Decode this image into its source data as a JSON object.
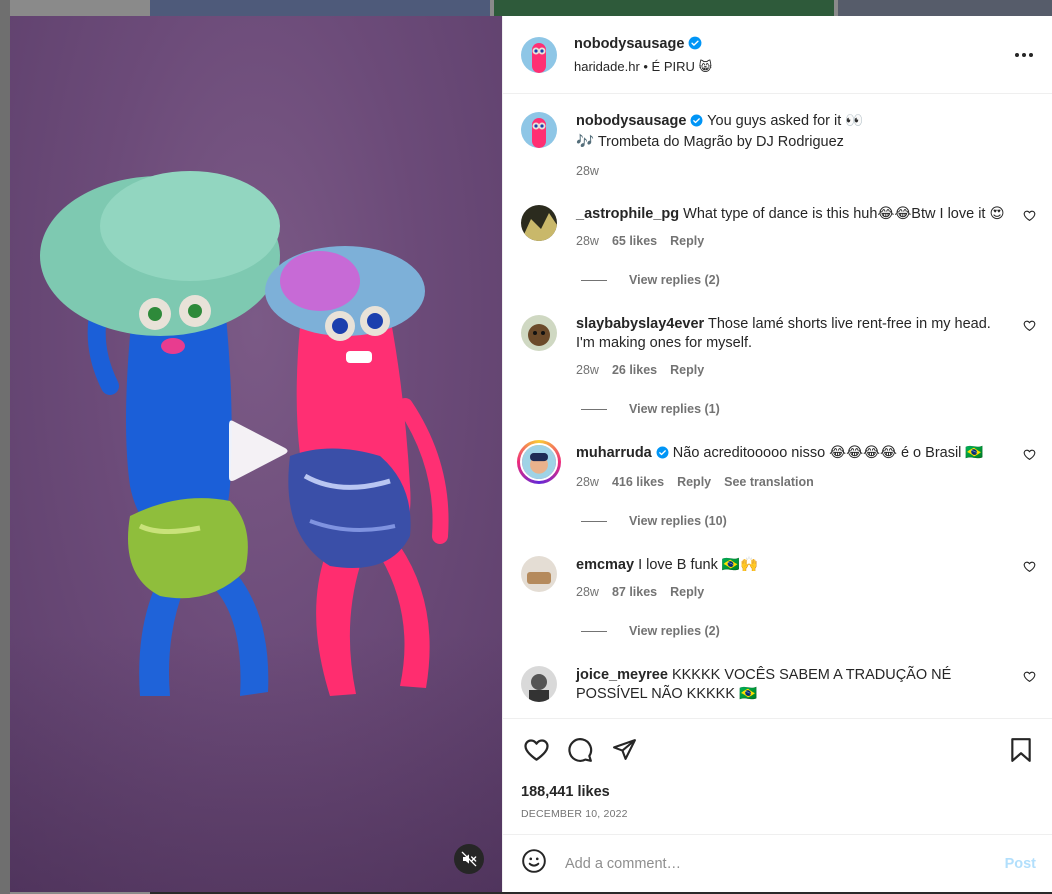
{
  "post": {
    "author": "nobodysausage",
    "location_line": "haridade.hr • É PIRU 😸",
    "caption_text": "You guys asked for it 👀",
    "caption_music": "🎶 Trombeta do Magrão by DJ Rodriguez",
    "caption_time": "28w",
    "likes": "188,441 likes",
    "date": "DECEMBER 10, 2022"
  },
  "comments": [
    {
      "user": "_astrophile_pg",
      "text": "What type of dance is this huh😂😂Btw I love it 😍",
      "time": "28w",
      "likes": "65 likes",
      "reply": "Reply",
      "view_replies": "View replies (2)"
    },
    {
      "user": "slaybabyslay4ever",
      "text": "Those lamé shorts live rent-free in my head. I'm making ones for myself.",
      "time": "28w",
      "likes": "26 likes",
      "reply": "Reply",
      "view_replies": "View replies (1)"
    },
    {
      "user": "muharruda",
      "text": "Não acreditooooo nisso 😂😂😂😂 é o Brasil 🇧🇷",
      "time": "28w",
      "likes": "416 likes",
      "reply": "Reply",
      "translate": "See translation",
      "view_replies": "View replies (10)"
    },
    {
      "user": "emcmay",
      "text": "I love B funk 🇧🇷🙌",
      "time": "28w",
      "likes": "87 likes",
      "reply": "Reply",
      "view_replies": "View replies (2)"
    },
    {
      "user": "joice_meyree",
      "text": "KKKKK VOCÊS SABEM A TRADUÇÃO NÉ POSSÍVEL NÃO KKKKK 🇧🇷"
    }
  ],
  "composer": {
    "placeholder": "Add a comment…",
    "post_label": "Post"
  },
  "icons": {
    "verified": "verified-badge-icon",
    "more": "more-options-icon",
    "like": "heart-icon",
    "comment": "comment-icon",
    "share": "share-icon",
    "save": "bookmark-icon",
    "emoji": "emoji-icon",
    "play": "play-icon",
    "mute": "muted-speaker-icon"
  },
  "colors": {
    "verified_blue": "#0095f6",
    "post_disabled": "#b2dffc",
    "muted_text": "#737373"
  }
}
